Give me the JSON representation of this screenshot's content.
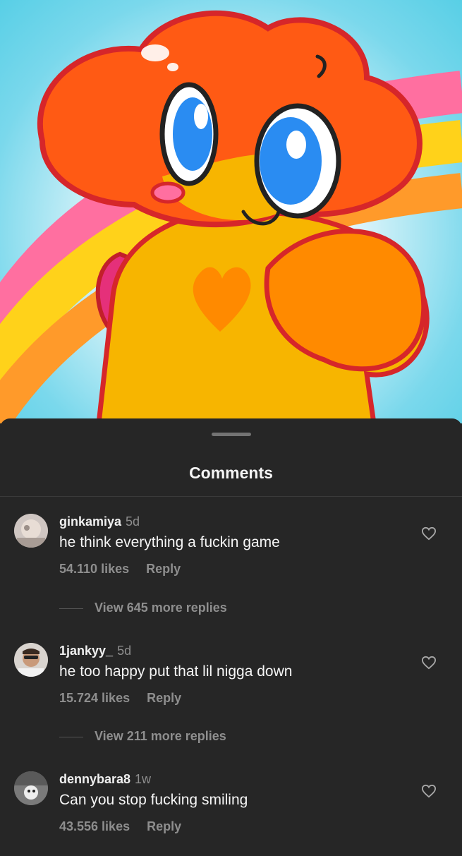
{
  "sheet": {
    "title": "Comments"
  },
  "comments": [
    {
      "username": "ginkamiya",
      "time": "5d",
      "text": "he think everything a fuckin game",
      "likes": "54.110 likes",
      "reply_label": "Reply",
      "view_replies": "View 645 more replies"
    },
    {
      "username": "1jankyy_",
      "time": "5d",
      "text": "he too happy put that lil nigga down",
      "likes": "15.724 likes",
      "reply_label": "Reply",
      "view_replies": "View 211 more replies"
    },
    {
      "username": "dennybara8",
      "time": "1w",
      "text": "Can you stop fucking smiling",
      "likes": "43.556 likes",
      "reply_label": "Reply"
    }
  ],
  "colors": {
    "sheet_bg": "#262626",
    "text_primary": "#f5f5f5",
    "text_secondary": "#8e8e8e",
    "art_orange": "#ff6a1f",
    "art_yellow": "#f7b500",
    "art_outline": "#d6262a"
  },
  "icons": [
    "heart-outline-icon",
    "avatar-photo"
  ]
}
